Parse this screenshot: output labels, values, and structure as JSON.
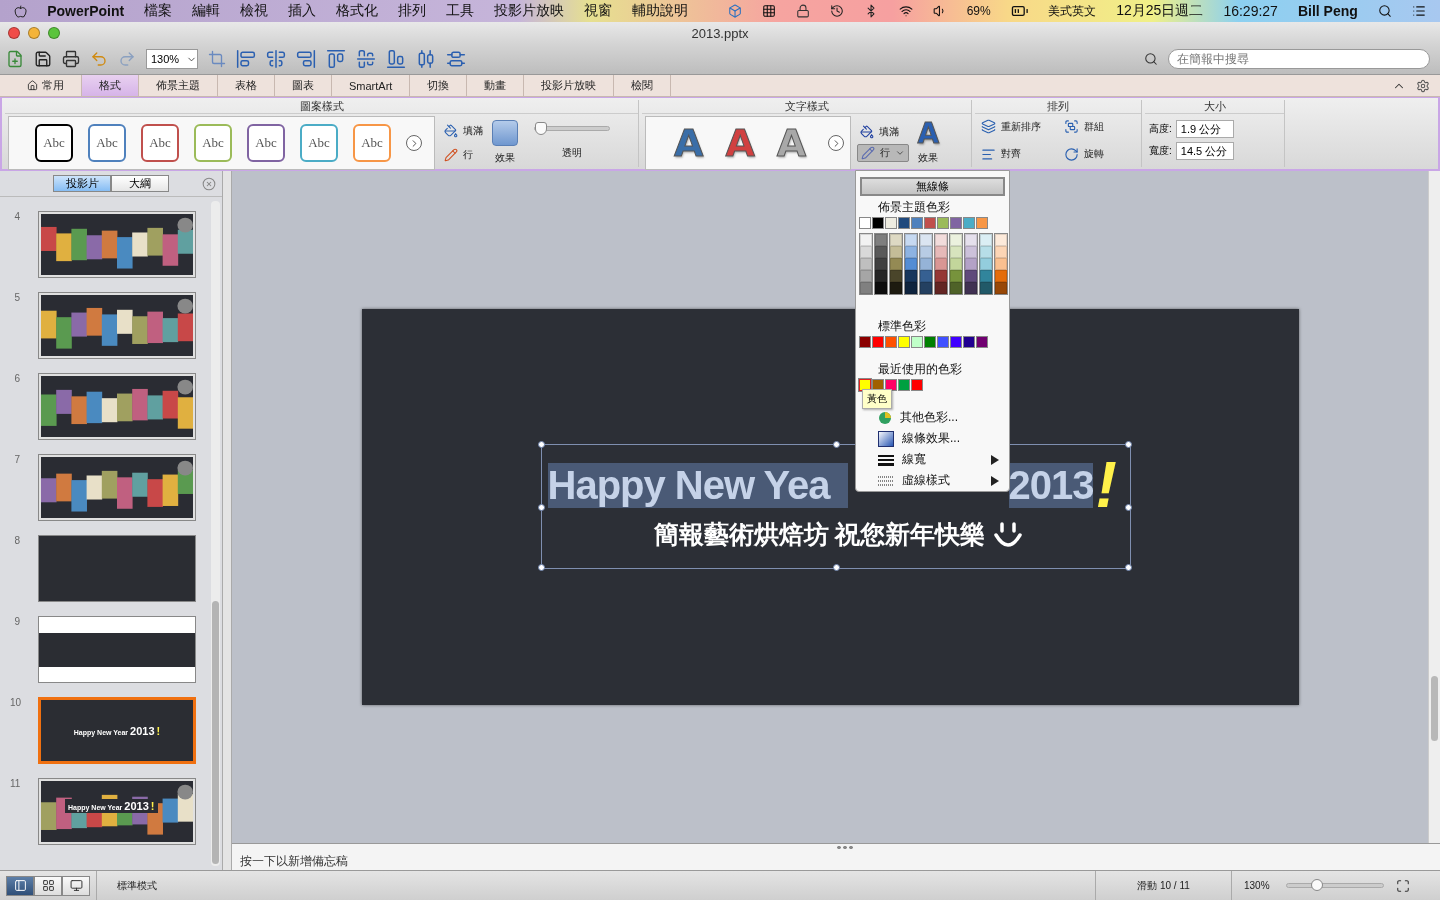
{
  "menubar": {
    "app": "PowerPoint",
    "menus": [
      "檔案",
      "編輯",
      "檢視",
      "插入",
      "格式化",
      "排列",
      "工具",
      "投影片放映",
      "視窗",
      "輔助說明"
    ],
    "status": {
      "battery": "69%",
      "input": "美式英文",
      "date": "12月25日週二",
      "time": "16:29:27",
      "user": "Bill Peng"
    }
  },
  "window": {
    "title": "2013.pptx"
  },
  "toolbar": {
    "zoom": "130%",
    "search": {
      "placeholder": "在簡報中搜尋"
    }
  },
  "ribbon_tabs": [
    {
      "label": "常用",
      "selected": false
    },
    {
      "label": "格式",
      "selected": true
    },
    {
      "label": "佈景主題",
      "selected": false
    },
    {
      "label": "表格",
      "selected": false
    },
    {
      "label": "圖表",
      "selected": false
    },
    {
      "label": "SmartArt",
      "selected": false
    },
    {
      "label": "切換",
      "selected": false
    },
    {
      "label": "動畫",
      "selected": false
    },
    {
      "label": "投影片放映",
      "selected": false
    },
    {
      "label": "檢閱",
      "selected": false
    }
  ],
  "ribbon": {
    "shape_styles": {
      "title": "圖案樣式",
      "swatches": [
        {
          "label": "Abc",
          "color": "#000000"
        },
        {
          "label": "Abc",
          "color": "#4f81bd"
        },
        {
          "label": "Abc",
          "color": "#c0504d"
        },
        {
          "label": "Abc",
          "color": "#9bbb59"
        },
        {
          "label": "Abc",
          "color": "#8064a2"
        },
        {
          "label": "Abc",
          "color": "#4bacc6"
        },
        {
          "label": "Abc",
          "color": "#f79646"
        }
      ],
      "fill": "填滿",
      "line": "行",
      "effects": "效果",
      "transparency": {
        "label": "透明",
        "level": 0
      }
    },
    "text_styles": {
      "title": "文字樣式",
      "styles": [
        {
          "label": "A",
          "color": "#3a6ea8"
        },
        {
          "label": "A",
          "color": "#d04040"
        },
        {
          "label": "A",
          "color": "#a8a8a8"
        }
      ],
      "fill": "填滿",
      "line": {
        "label": "行",
        "pressed": true
      },
      "effects_glyph": "A",
      "effects": "效果"
    },
    "arrange": {
      "title": "排列",
      "items": [
        {
          "label": "重新排序",
          "kind": "reorder"
        },
        {
          "label": "群組",
          "kind": "group"
        },
        {
          "label": "對齊",
          "kind": "align"
        },
        {
          "label": "旋轉",
          "kind": "rotate"
        }
      ]
    },
    "size": {
      "title": "大小",
      "height": {
        "label": "高度:",
        "value": "1.9 公分"
      },
      "width": {
        "label": "寬度:",
        "value": "14.5 公分"
      }
    }
  },
  "sidebar": {
    "tabs": [
      {
        "label": "投影片",
        "selected": true
      },
      {
        "label": "大綱",
        "selected": false
      }
    ],
    "slides": [
      {
        "number": "4",
        "kind": "photos",
        "selected": false
      },
      {
        "number": "5",
        "kind": "photos",
        "selected": false
      },
      {
        "number": "6",
        "kind": "photos",
        "selected": false
      },
      {
        "number": "7",
        "kind": "photos",
        "selected": false
      },
      {
        "number": "8",
        "kind": "dark",
        "selected": false
      },
      {
        "number": "9",
        "kind": "banded",
        "selected": false
      },
      {
        "number": "10",
        "kind": "title",
        "title": "Happy New Year",
        "year": "2013",
        "mark": "!",
        "selected": true
      },
      {
        "number": "11",
        "kind": "photo-title",
        "title": "Happy New Year",
        "year": "2013",
        "mark": "!",
        "selected": false
      }
    ]
  },
  "slide": {
    "title_parts": [
      "Happy New Yea",
      "2013"
    ],
    "mark": "!",
    "subtitle": "簡報藝術烘焙坊 祝您新年快樂"
  },
  "line_menu": {
    "no_line": "無線條",
    "theme_title": "佈景主題色彩",
    "theme_colors": [
      {
        "color": "#ffffff",
        "shades": [
          {
            "color": "#f2f2f2"
          },
          {
            "color": "#d9d9d9"
          },
          {
            "color": "#bfbfbf"
          },
          {
            "color": "#a6a6a6"
          },
          {
            "color": "#808080"
          }
        ]
      },
      {
        "color": "#000000",
        "shades": [
          {
            "color": "#7f7f7f"
          },
          {
            "color": "#595959"
          },
          {
            "color": "#404040"
          },
          {
            "color": "#262626"
          },
          {
            "color": "#0d0d0d"
          }
        ]
      },
      {
        "color": "#eeece1",
        "shades": [
          {
            "color": "#ddd9c3"
          },
          {
            "color": "#c4bd97"
          },
          {
            "color": "#948a54"
          },
          {
            "color": "#4a452a"
          },
          {
            "color": "#1d1b10"
          }
        ]
      },
      {
        "color": "#1f497d",
        "shades": [
          {
            "color": "#c6d9f1"
          },
          {
            "color": "#8db3e2"
          },
          {
            "color": "#548dd4"
          },
          {
            "color": "#17365d"
          },
          {
            "color": "#0f243e"
          }
        ]
      },
      {
        "color": "#4f81bd",
        "shades": [
          {
            "color": "#dbe5f1"
          },
          {
            "color": "#b8cce4"
          },
          {
            "color": "#95b3d7"
          },
          {
            "color": "#366092"
          },
          {
            "color": "#244061"
          }
        ]
      },
      {
        "color": "#c0504d",
        "shades": [
          {
            "color": "#f2dcdb"
          },
          {
            "color": "#e6b9b8"
          },
          {
            "color": "#d99694"
          },
          {
            "color": "#953735"
          },
          {
            "color": "#632523"
          }
        ]
      },
      {
        "color": "#9bbb59",
        "shades": [
          {
            "color": "#ebf1de"
          },
          {
            "color": "#d7e4bd"
          },
          {
            "color": "#c3d69b"
          },
          {
            "color": "#77933c"
          },
          {
            "color": "#4f6228"
          }
        ]
      },
      {
        "color": "#8064a2",
        "shades": [
          {
            "color": "#e5e0ec"
          },
          {
            "color": "#ccc1da"
          },
          {
            "color": "#b3a2c7"
          },
          {
            "color": "#604a7b"
          },
          {
            "color": "#403152"
          }
        ]
      },
      {
        "color": "#4bacc6",
        "shades": [
          {
            "color": "#dbeef4"
          },
          {
            "color": "#b7dee8"
          },
          {
            "color": "#93cddd"
          },
          {
            "color": "#31859c"
          },
          {
            "color": "#215968"
          }
        ]
      },
      {
        "color": "#f79646",
        "shades": [
          {
            "color": "#fdeada"
          },
          {
            "color": "#fcd5b5"
          },
          {
            "color": "#fac090"
          },
          {
            "color": "#e46c0a"
          },
          {
            "color": "#984807"
          }
        ]
      }
    ],
    "standard_title": "標準色彩",
    "standard_colors": [
      {
        "color": "#8b0000"
      },
      {
        "color": "#ff0000"
      },
      {
        "color": "#ff5000"
      },
      {
        "color": "#ffff00"
      },
      {
        "color": "#c0ffc8"
      },
      {
        "color": "#008000"
      },
      {
        "color": "#4050ff"
      },
      {
        "color": "#4000ff"
      },
      {
        "color": "#200090"
      },
      {
        "color": "#700070"
      }
    ],
    "recent_title": "最近使用的色彩",
    "recent_colors": [
      {
        "color": "#ffff00",
        "selected": true
      },
      {
        "color": "#a06000",
        "selected": false
      },
      {
        "color": "#ff0066",
        "selected": false
      },
      {
        "color": "#00a040",
        "selected": false
      },
      {
        "color": "#ff0000",
        "selected": false
      }
    ],
    "tooltip": "黃色",
    "items": [
      {
        "label": "其他色彩...",
        "kind": "wheel",
        "submenu": false
      },
      {
        "label": "線條效果...",
        "kind": "effects",
        "submenu": false
      },
      {
        "label": "線寬",
        "kind": "weight",
        "submenu": true
      },
      {
        "label": "虛線樣式",
        "kind": "dash",
        "submenu": true
      }
    ]
  },
  "notes": {
    "placeholder": "按一下以新增備忘稿"
  },
  "status_bar": {
    "views": [
      {
        "kind": "normal",
        "selected": true
      },
      {
        "kind": "sorter",
        "selected": false
      },
      {
        "kind": "show",
        "selected": false
      }
    ],
    "mode": "標準模式",
    "slide": "滑動 10 / 11",
    "zoom": "130%",
    "zoom_slider": {
      "level": 0.32
    }
  }
}
